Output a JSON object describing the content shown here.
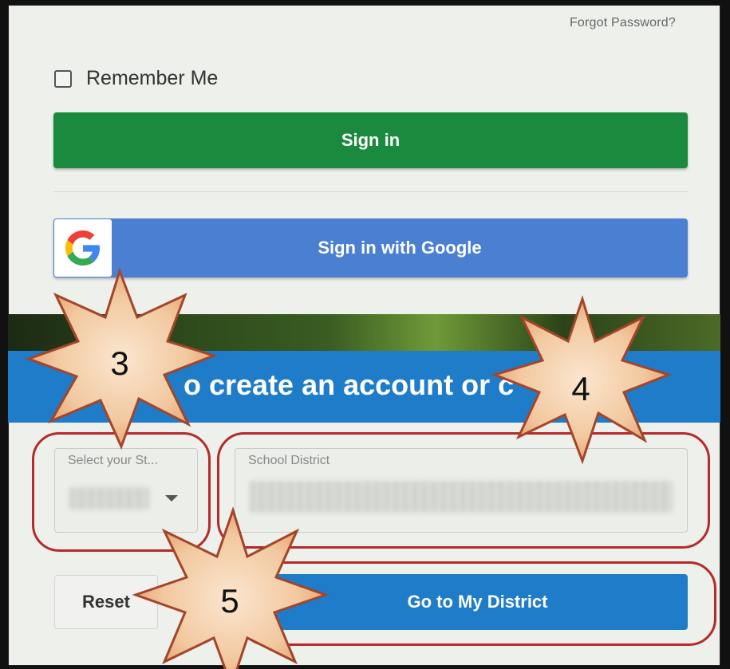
{
  "login": {
    "forgot_password": "Forgot Password?",
    "remember_me": "Remember Me",
    "sign_in": "Sign in",
    "google_sign_in": "Sign in with Google"
  },
  "district_finder": {
    "banner_text": "o create an account or c",
    "state_label": "Select your St...",
    "district_label": "School District",
    "reset": "Reset",
    "go_to_district": "Go to My District"
  },
  "annotations": {
    "step_3": "3",
    "step_4": "4",
    "step_5": "5"
  },
  "colors": {
    "sign_in_green": "#1a8a3e",
    "google_blue": "#4a7fd1",
    "banner_blue": "#1e7cc8",
    "annotation_red": "#b52a2a",
    "burst_fill": "#f2c9a0"
  }
}
